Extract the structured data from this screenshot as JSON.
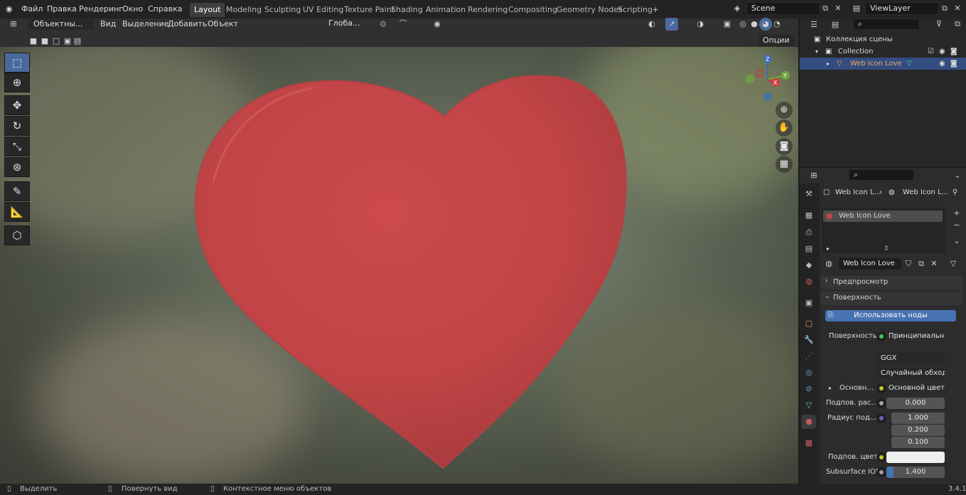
{
  "menu": {
    "file": "Файл",
    "edit": "Правка",
    "render": "Рендеринг",
    "window": "Окно",
    "help": "Справка"
  },
  "workspaces": [
    "Layout",
    "Modeling",
    "Sculpting",
    "UV Editing",
    "Texture Paint",
    "Shading",
    "Animation",
    "Rendering",
    "Compositing",
    "Geometry Nodes",
    "Scripting"
  ],
  "scene": "Scene",
  "view_layer": "ViewLayer",
  "viewport_header": {
    "mode": "Объектны...",
    "view": "Вид",
    "select": "Выделение",
    "add": "Добавить",
    "object": "Объект",
    "transform": "Глоба...",
    "options": "Опции"
  },
  "outliner": {
    "scene_collection": "Коллекция сцены",
    "collection": "Collection",
    "object": "Web Icon Love"
  },
  "properties": {
    "breadcrumb": [
      "Web Icon L...",
      "Web Icon L..."
    ],
    "material_slot": "Web Icon Love",
    "material_name": "Web Icon Love",
    "preview": "Предпросмотр",
    "surface_panel": "Поверхность",
    "use_nodes": "Использовать ноды",
    "surface_label": "Поверхность",
    "surface_value": "Принципиальн...",
    "distribution": "GGX",
    "subsurface_method": "Случайный обход",
    "base_label": "Основн...",
    "base_value": "Основной цвет",
    "subsurface_label": "Подпов. рас...",
    "subsurface_value": "0.000",
    "radius_label": "Радиус под...",
    "radius": [
      "1.000",
      "0.200",
      "0.100"
    ],
    "subsurface_color_label": "Подпов. цвет",
    "ior_label": "Subsurface IOR",
    "ior_value": "1.400"
  },
  "status": {
    "select": "Выделить",
    "rotate": "Повернуть вид",
    "context": "Контекстное меню объектов",
    "version": "3.4.1"
  },
  "colors": {
    "heart": "#c54646",
    "active_tab": "#3e3e3e",
    "accent": "#4a6a9c",
    "selected_row": "#334d80"
  }
}
